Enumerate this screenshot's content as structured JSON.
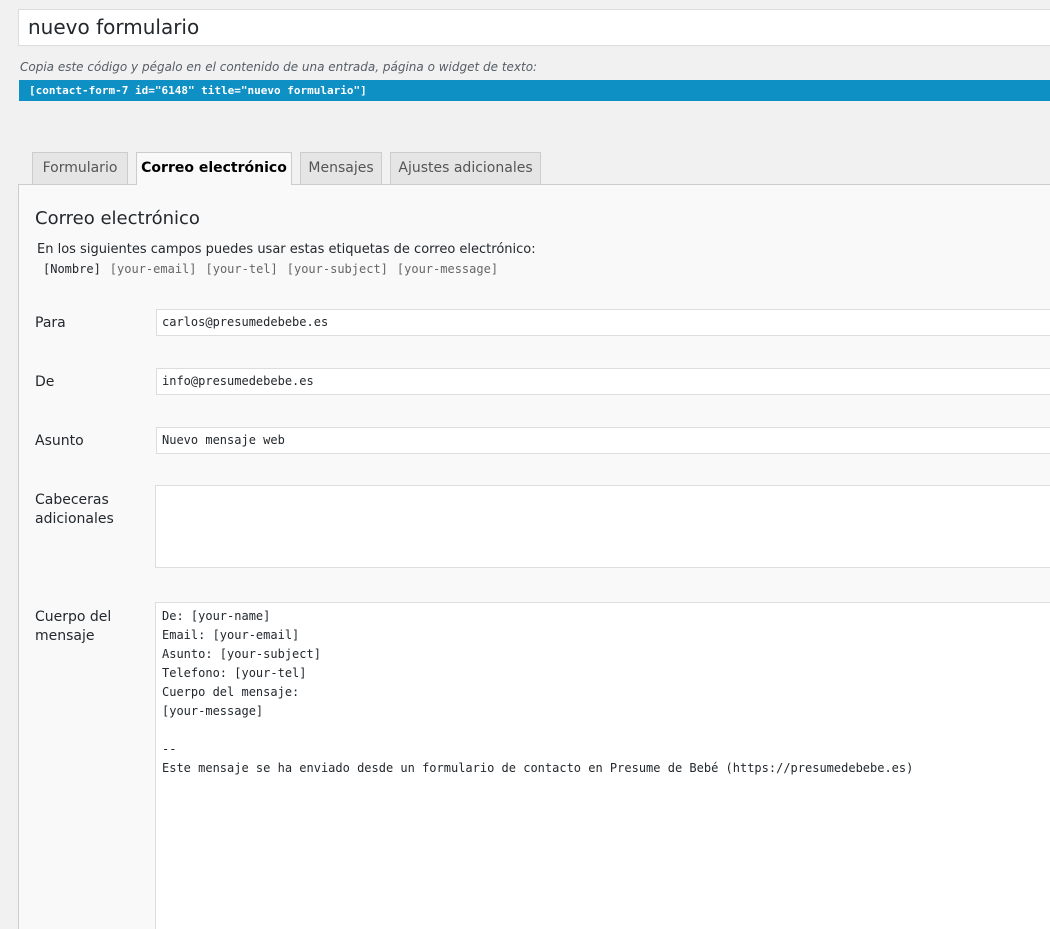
{
  "form_title": "nuevo formulario",
  "shortcode": {
    "description": "Copia este código y pégalo en el contenido de una entrada, página o widget de texto:",
    "code": "[contact-form-7 id=\"6148\" title=\"nuevo formulario\"]"
  },
  "tabs": [
    {
      "label": "Formulario",
      "active": false
    },
    {
      "label": "Correo electrónico",
      "active": true
    },
    {
      "label": "Mensajes",
      "active": false
    },
    {
      "label": "Ajustes adicionales",
      "active": false
    }
  ],
  "mail": {
    "heading": "Correo electrónico",
    "intro": "En los siguientes campos puedes usar estas etiquetas de correo electrónico:",
    "tags": [
      {
        "text": "[Nombre]",
        "used": true
      },
      {
        "text": "[your-email]",
        "used": false
      },
      {
        "text": "[your-tel]",
        "used": false
      },
      {
        "text": "[your-subject]",
        "used": false
      },
      {
        "text": "[your-message]",
        "used": false
      }
    ],
    "to": {
      "label": "Para",
      "value": "carlos@presumedebebe.es"
    },
    "from": {
      "label": "De",
      "value": "info@presumedebebe.es"
    },
    "subject": {
      "label": "Asunto",
      "value": "Nuevo mensaje web"
    },
    "headers": {
      "label_line1": "Cabeceras",
      "label_line2": "adicionales",
      "value": ""
    },
    "body": {
      "label_line1": "Cuerpo del",
      "label_line2": "mensaje",
      "lines": [
        "De: [your-name]",
        "Email: [your-email]",
        "Asunto: [your-subject]",
        "Telefono: [your-tel]",
        "Cuerpo del mensaje:",
        "[your-message]",
        "",
        "--",
        "Este mensaje se ha enviado desde un formulario de contacto en Presume de Bebé (https://presumedebebe.es)"
      ]
    }
  },
  "colors": {
    "shortcode_bar": "#0e90c5",
    "page_background": "#f1f1f1",
    "panel_background": "#f9f9f9"
  }
}
